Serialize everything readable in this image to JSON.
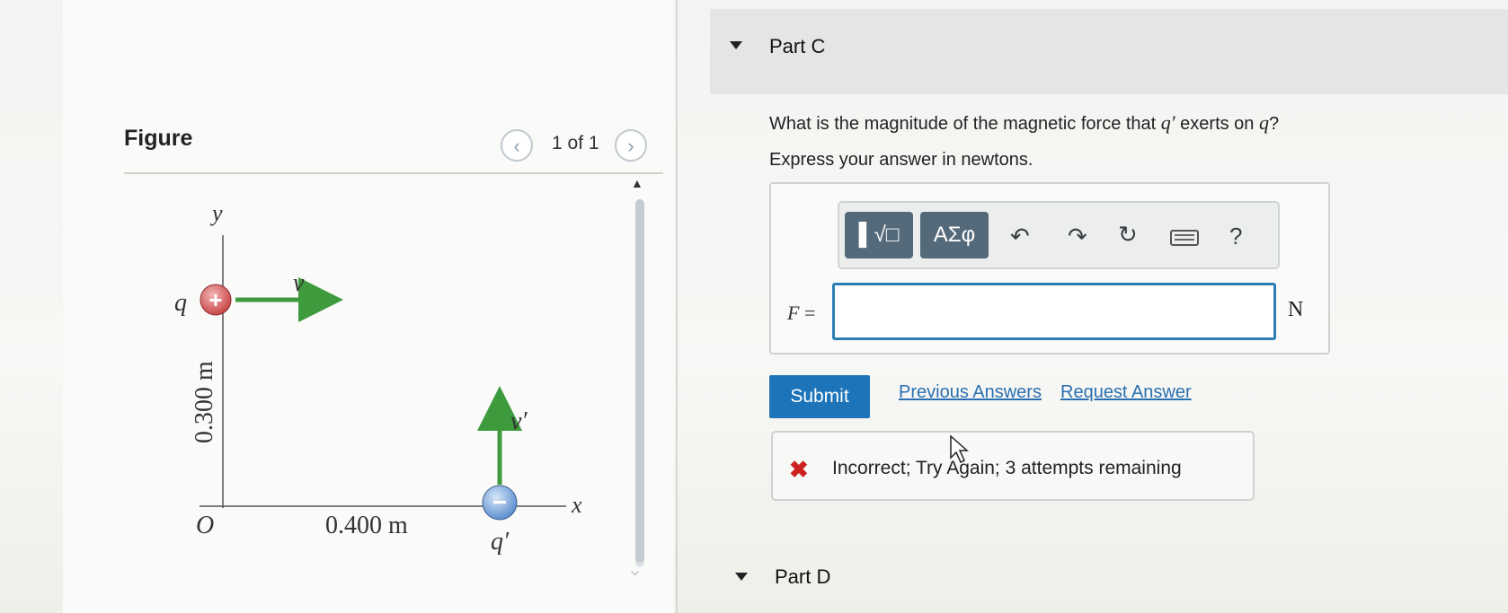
{
  "figure": {
    "title": "Figure",
    "page_count": "1 of 1",
    "prev_icon": "chevron-left-icon",
    "next_icon": "chevron-right-icon",
    "diagram": {
      "axis_y_label": "y",
      "axis_x_label": "x",
      "origin_label": "O",
      "charge_q_label": "q",
      "charge_q_sign": "+",
      "charge_q_prime_label": "q′",
      "charge_q_prime_sign": "−",
      "velocity_v_label": "v",
      "velocity_v_prime_label": "v′",
      "distance_y_label": "0.300 m",
      "distance_x_label": "0.400 m"
    },
    "colors": {
      "arrow": "#3d9a3d",
      "positive_charge": "#d65a5a",
      "negative_charge": "#6a9ed8"
    }
  },
  "part_c": {
    "label": "Part C",
    "question_pre": "What is the magnitude of the magnetic force that ",
    "question_var1": "q′",
    "question_mid": " exerts on ",
    "question_var2": "q",
    "question_post": "?",
    "instruction": "Express your answer in newtons.",
    "toolbar": {
      "templates_icon": "fraction-radical-icon",
      "templates_label": "▌√□",
      "symbols_label": "ΑΣφ",
      "undo_icon": "undo-icon",
      "redo_icon": "redo-icon",
      "reset_icon": "reset-icon",
      "keyboard_icon": "keyboard-icon",
      "help_label": "?"
    },
    "answer": {
      "var_label": "F",
      "eq": " =",
      "value": "",
      "unit": "N"
    },
    "submit_label": "Submit",
    "previous_answers_label": "Previous Answers",
    "request_answer_label": "Request Answer",
    "feedback": {
      "icon": "x-icon",
      "mark": "✖",
      "text": "Incorrect; Try Again; 3 attempts remaining"
    }
  },
  "part_d": {
    "label": "Part D"
  }
}
